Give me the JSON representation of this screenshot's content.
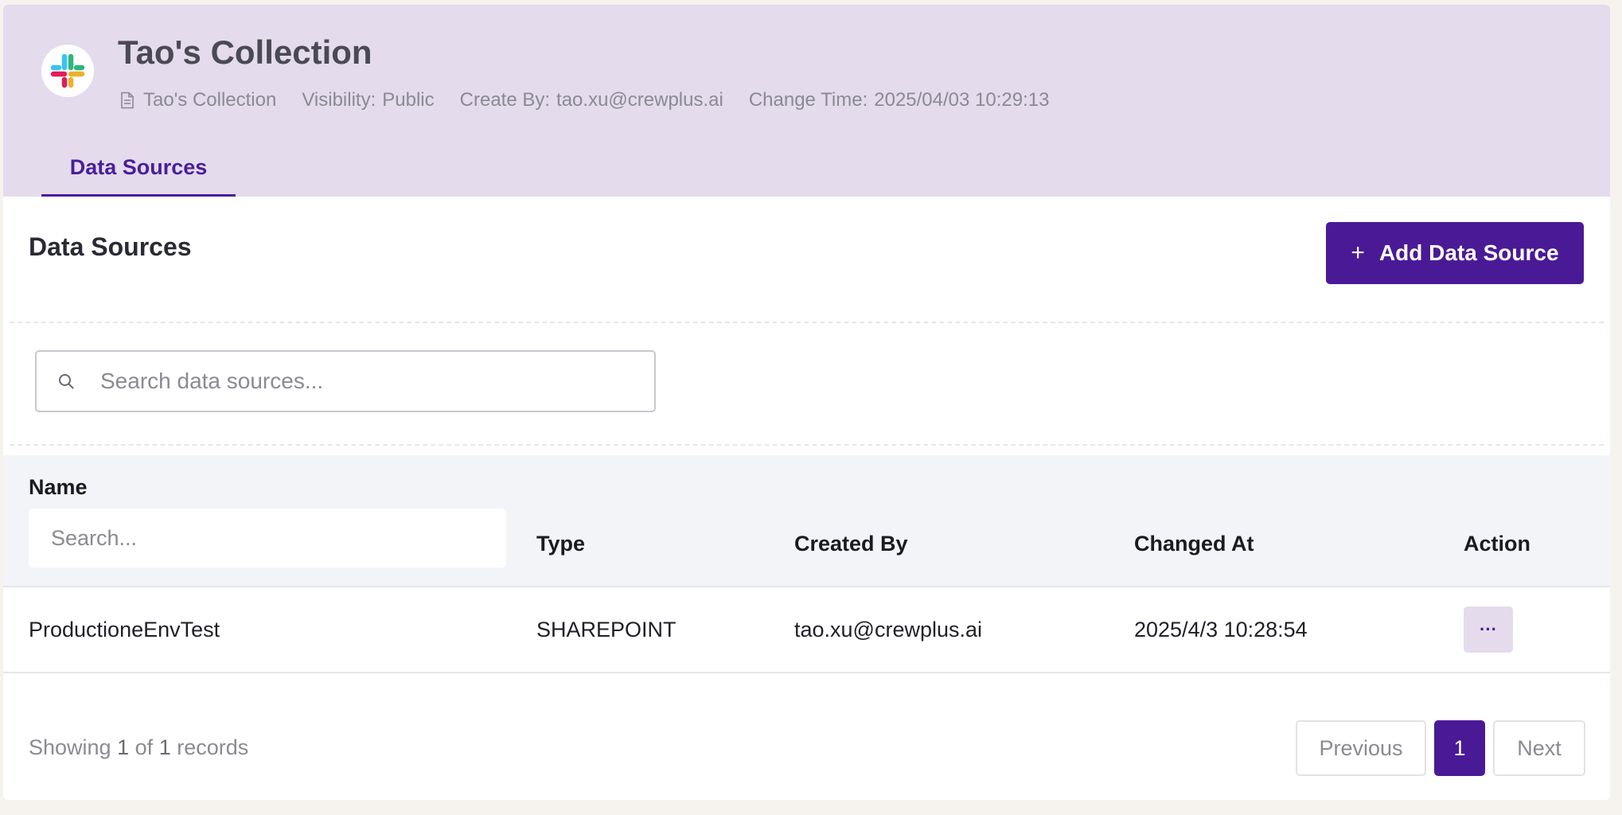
{
  "collection": {
    "title": "Tao's Collection",
    "doc_icon": "document-icon",
    "name": "Tao's Collection",
    "visibility_label": "Visibility:",
    "visibility_value": "Public",
    "created_by_label": "Create By:",
    "created_by_value": "tao.xu@crewplus.ai",
    "change_time_label": "Change Time:",
    "change_time_value": "2025/04/03 10:29:13"
  },
  "tabs": [
    {
      "label": "Data Sources",
      "active": true
    }
  ],
  "section": {
    "title": "Data Sources",
    "add_button": {
      "icon": "plus-icon",
      "label": "Add Data Source"
    }
  },
  "search": {
    "icon": "search-icon",
    "placeholder": "Search data sources...",
    "value": ""
  },
  "table": {
    "columns": {
      "name": "Name",
      "type": "Type",
      "created_by": "Created By",
      "changed_at": "Changed At",
      "action": "Action"
    },
    "name_filter_placeholder": "Search...",
    "rows": [
      {
        "name": "ProductioneEnvTest",
        "type": "SHAREPOINT",
        "created_by": "tao.xu@crewplus.ai",
        "changed_at": "2025/4/3 10:28:54",
        "action": "···"
      }
    ]
  },
  "footer": {
    "showing_prefix": "Showing",
    "showing_from": "1",
    "showing_of": "of",
    "showing_total": "1",
    "showing_suffix": "records",
    "previous_label": "Previous",
    "current_page": "1",
    "next_label": "Next"
  },
  "colors": {
    "accent": "#4a1a96",
    "header_bg": "#e4dbec",
    "page_bg": "#f6f3ee"
  }
}
